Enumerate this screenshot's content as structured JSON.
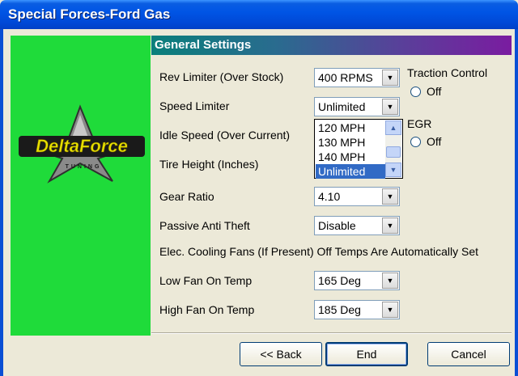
{
  "window": {
    "title": "Special Forces-Ford Gas"
  },
  "logo": {
    "text": "DeltaForce",
    "subtext": "TUNING"
  },
  "section": {
    "title": "General Settings"
  },
  "settings": {
    "rev_limiter": {
      "label": "Rev Limiter (Over Stock)",
      "value": "400 RPMS"
    },
    "speed_limiter": {
      "label": "Speed Limiter",
      "value": "Unlimited",
      "options_visible": [
        "120 MPH",
        "130 MPH",
        "140 MPH",
        "Unlimited"
      ],
      "highlighted": "Unlimited"
    },
    "idle_speed": {
      "label": "Idle Speed (Over Current)"
    },
    "tire_height": {
      "label": "Tire Height (Inches)"
    },
    "gear_ratio": {
      "label": "Gear Ratio",
      "value": "4.10"
    },
    "passive_anti_theft": {
      "label": "Passive Anti Theft",
      "value": "Disable"
    },
    "cooling_note": "Elec. Cooling Fans (If Present) Off Temps Are Automatically Set",
    "low_fan": {
      "label": "Low Fan On Temp",
      "value": "165 Deg"
    },
    "high_fan": {
      "label": "High Fan On Temp",
      "value": "185 Deg"
    },
    "traction_control": {
      "label": "Traction Control",
      "option": "Off"
    },
    "egr": {
      "label": "EGR",
      "option": "Off"
    }
  },
  "buttons": {
    "back": "<< Back",
    "end": "End",
    "cancel": "Cancel"
  },
  "colors": {
    "titlebar": "#0055e5",
    "green_panel": "#1fdb3a",
    "selection": "#316ac5"
  }
}
